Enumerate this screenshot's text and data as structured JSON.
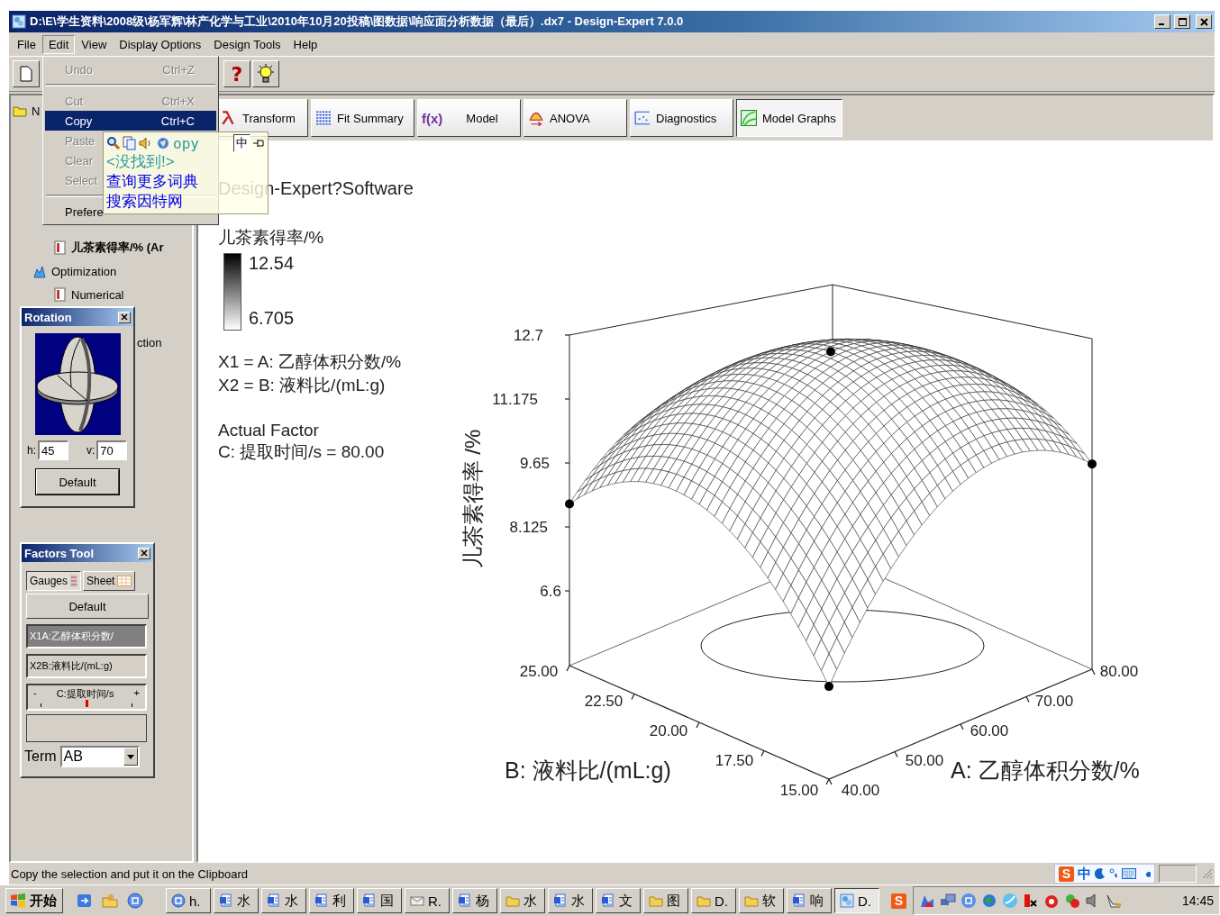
{
  "window": {
    "title": "D:\\E\\学生资料\\2008级\\杨军辉\\林产化学与工业\\2010年10月20投稿\\图数据\\响应面分析数据（最后）.dx7 - Design-Expert 7.0.0"
  },
  "menu_bar": [
    {
      "label": "File",
      "selected": false
    },
    {
      "label": "Edit",
      "selected": true
    },
    {
      "label": "View",
      "selected": false
    },
    {
      "label": "Display Options",
      "selected": false
    },
    {
      "label": "Design Tools",
      "selected": false
    },
    {
      "label": "Help",
      "selected": false
    }
  ],
  "toolbar": {
    "help": "?"
  },
  "edit_menu": [
    {
      "kind": "item",
      "label": "Undo",
      "shortcut": "Ctrl+Z",
      "disabled": true,
      "selected": false
    },
    {
      "kind": "separator"
    },
    {
      "kind": "item",
      "label": "Cut",
      "shortcut": "Ctrl+X",
      "disabled": true,
      "selected": false
    },
    {
      "kind": "item",
      "label": "Copy",
      "shortcut": "Ctrl+C",
      "disabled": false,
      "selected": true
    },
    {
      "kind": "item",
      "label": "Paste",
      "disabled": true,
      "selected": false
    },
    {
      "kind": "item",
      "label": "Clear",
      "disabled": true,
      "selected": false
    },
    {
      "kind": "item",
      "label": "Select",
      "disabled": true,
      "selected": false
    },
    {
      "kind": "separator"
    },
    {
      "kind": "item",
      "label": "Prefere",
      "disabled": false,
      "selected": false
    }
  ],
  "dictionary_popup": {
    "word": "opy",
    "mode_button": "中",
    "lines": [
      {
        "kind": "message",
        "text": "<没找到!>"
      },
      {
        "kind": "link",
        "text": "查询更多词典"
      },
      {
        "kind": "link",
        "text": "搜索因特网"
      }
    ]
  },
  "tree": [
    {
      "label": "N",
      "selected": false,
      "children": [
        {
          "label": "儿茶素得率/% (Ar",
          "selected": true
        },
        {
          "label": "Optimization",
          "selected": false,
          "children": [
            {
              "label": "Numerical",
              "selected": false
            },
            {
              "label": "ction",
              "selected": false
            }
          ]
        }
      ]
    }
  ],
  "rotation": {
    "title": "Rotation",
    "h_label": "h:",
    "h_value": "45",
    "v_label": "v:",
    "v_value": "70",
    "default_button": "Default"
  },
  "factors_tool": {
    "title": "Factors Tool",
    "tabs": [
      {
        "label": "Gauges",
        "selected": true
      },
      {
        "label": "Sheet",
        "selected": false
      }
    ],
    "default_button": "Default",
    "factors": [
      {
        "kind": "axis",
        "label": "X1A:乙醇体积分数/",
        "selected": true
      },
      {
        "kind": "axis",
        "label": "X2B:液料比/(mL:g)",
        "selected": false
      },
      {
        "kind": "gauge",
        "label": "C:提取时间/s",
        "minus": "-",
        "plus": "+",
        "level": 0.5
      }
    ],
    "term_label": "Term",
    "term_value": "AB"
  },
  "tabs": [
    {
      "label": "Transform",
      "selected": false
    },
    {
      "label": "Fit Summary",
      "selected": false
    },
    {
      "label": "Model",
      "glyph": "f(x)",
      "selected": false
    },
    {
      "label": "ANOVA",
      "selected": false
    },
    {
      "label": "Diagnostics",
      "selected": false
    },
    {
      "label": "Model Graphs",
      "selected": true
    }
  ],
  "plot": {
    "software": "Design-Expert?Software",
    "response": "儿茶素得率/%",
    "legend_high": "12.54",
    "legend_low": "6.705",
    "x1": "X1 = A: 乙醇体积分数/%",
    "x2": "X2 = B: 液料比/(mL:g)",
    "actual_factor_heading": "Actual Factor",
    "actual_factor": "C: 提取时间/s = 80.00",
    "z_label": "儿茶素得率 /%",
    "z_ticks": [
      "12.7",
      "11.175",
      "9.65",
      "8.125",
      "6.6"
    ],
    "b_label": "B: 液料比/(mL:g)",
    "b_ticks": [
      "25.00",
      "22.50",
      "20.00",
      "17.50",
      "15.00"
    ],
    "a_label": "A: 乙醇体积分数/%",
    "a_ticks": [
      "40.00",
      "50.00",
      "60.00",
      "70.00",
      "80.00"
    ]
  },
  "status_bar": {
    "text": "Copy the selection and put it on the Clipboard",
    "ime_logo": "S",
    "ime_mode": "中"
  },
  "taskbar": {
    "start": "开始",
    "buttons": [
      {
        "kind": "app",
        "label": "h.",
        "selected": false
      },
      {
        "kind": "doc",
        "label": "水",
        "selected": false
      },
      {
        "kind": "doc",
        "label": "水",
        "selected": false
      },
      {
        "kind": "doc",
        "label": "利",
        "selected": false
      },
      {
        "kind": "doc",
        "label": "国",
        "selected": false
      },
      {
        "kind": "mail",
        "label": "R.",
        "selected": false
      },
      {
        "kind": "doc",
        "label": "杨",
        "selected": false
      },
      {
        "kind": "folder",
        "label": "水",
        "selected": false
      },
      {
        "kind": "doc",
        "label": "水",
        "selected": false
      },
      {
        "kind": "doc",
        "label": "文",
        "selected": false
      },
      {
        "kind": "folder",
        "label": "图",
        "selected": false
      },
      {
        "kind": "folder",
        "label": "D.",
        "selected": false
      },
      {
        "kind": "folder",
        "label": "软",
        "selected": false
      },
      {
        "kind": "doc",
        "label": "响",
        "selected": false
      },
      {
        "kind": "design",
        "label": "D.",
        "selected": true
      }
    ],
    "tray_logo": "S",
    "clock": "14:45"
  }
}
